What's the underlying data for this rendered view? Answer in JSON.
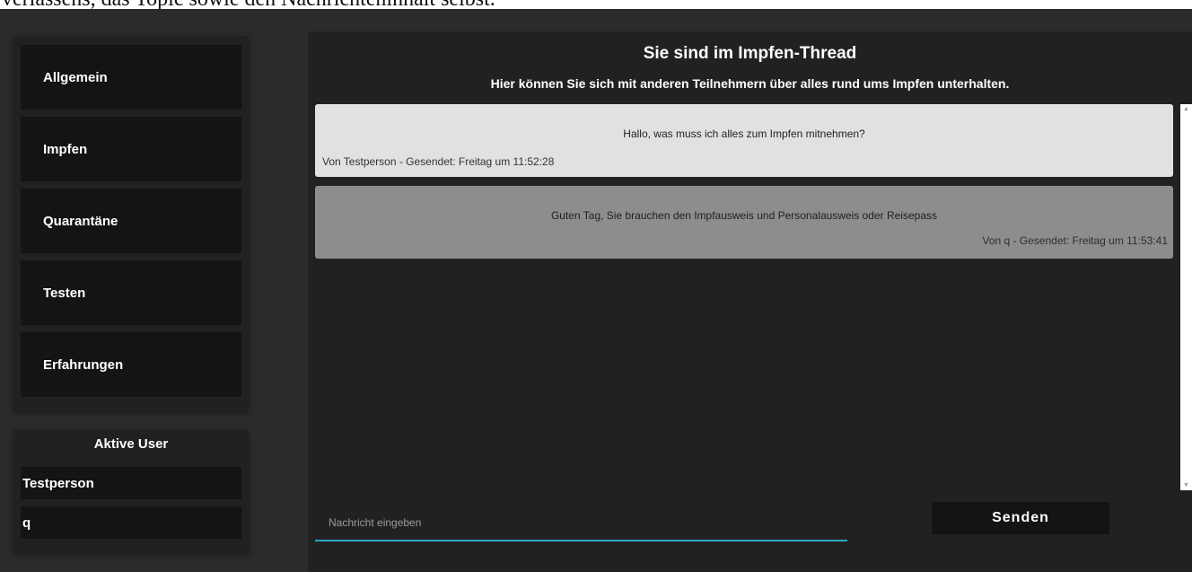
{
  "page_header_text": "verlassens, das Topic sowie den Nachrichteninhalt selbst.",
  "sidebar": {
    "items": [
      {
        "label": "Allgemein"
      },
      {
        "label": "Impfen"
      },
      {
        "label": "Quarantäne"
      },
      {
        "label": "Testen"
      },
      {
        "label": "Erfahrungen"
      }
    ]
  },
  "active_users": {
    "title": "Aktive User",
    "users": [
      "Testperson",
      "q"
    ]
  },
  "thread": {
    "title": "Sie sind im Impfen-Thread",
    "subtitle": "Hier können Sie sich mit anderen Teilnehmern über alles rund ums Impfen unterhalten."
  },
  "messages": [
    {
      "text": "Hallo, was muss ich alles zum Impfen mitnehmen?",
      "meta": "Von Testperson - Gesendet: Freitag um 11:52:28"
    },
    {
      "text": "Guten Tag, Sie brauchen den Impfausweis und Personalausweis oder Reisepass",
      "meta": "Von q - Gesendet: Freitag um 11:53:41"
    }
  ],
  "composer": {
    "placeholder": "Nachricht eingeben",
    "send_label": "Senden"
  },
  "colors": {
    "app_background": "#2b2b2b",
    "panel_background": "#212121",
    "item_background": "#141414",
    "own_message": "#e1e1e1",
    "other_message": "#8d8d8d",
    "input_underline": "#2aa6c4"
  }
}
